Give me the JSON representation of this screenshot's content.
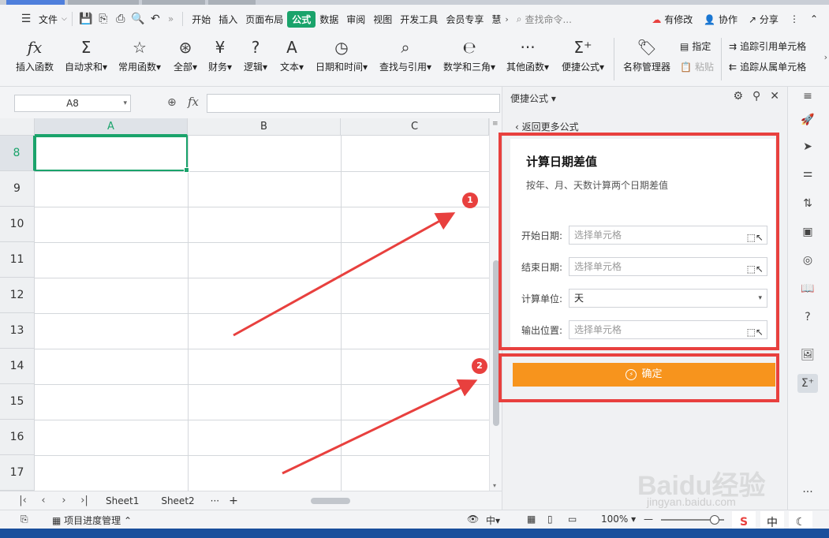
{
  "menubar": {
    "file_label": "文件",
    "tabs": [
      "开始",
      "插入",
      "页面布局",
      "公式",
      "数据",
      "审阅",
      "视图",
      "开发工具",
      "会员专享",
      "慧"
    ],
    "active_tab": "公式",
    "more": "»",
    "search_placeholder": "查找命令...",
    "modified": "有修改",
    "collab": "协作",
    "share": "分享"
  },
  "ribbon": {
    "buttons": [
      "插入函数",
      "自动求和",
      "常用函数",
      "全部",
      "财务",
      "逻辑",
      "文本",
      "日期和时间",
      "查找与引用",
      "数学和三角",
      "其他函数",
      "便捷公式",
      "名称管理器"
    ],
    "assign": "指定",
    "paste": "粘贴",
    "trace_precedents": "追踪引用单元格",
    "trace_dependents": "追踪从属单元格"
  },
  "formula_bar": {
    "name_box": "A8",
    "fx": "fx",
    "value": ""
  },
  "grid": {
    "columns": [
      "A",
      "B",
      "C"
    ],
    "rows": [
      "8",
      "9",
      "10",
      "11",
      "12",
      "13",
      "14",
      "15",
      "16",
      "17"
    ],
    "selected_col": "A",
    "selected_row": "8"
  },
  "sheets": {
    "tabs": [
      "Sheet1",
      "Sheet2"
    ],
    "more": "···",
    "add": "+"
  },
  "panel": {
    "title": "便捷公式",
    "back": "返回更多公式",
    "card_title": "计算日期差值",
    "card_desc": "按年、月、天数计算两个日期差值",
    "fields": [
      {
        "label": "开始日期:",
        "placeholder": "选择单元格"
      },
      {
        "label": "结束日期:",
        "placeholder": "选择单元格"
      },
      {
        "label": "计算单位:",
        "value": "天"
      },
      {
        "label": "输出位置:",
        "placeholder": "选择单元格"
      }
    ],
    "confirm": "确定"
  },
  "annotations": {
    "marker1": "1",
    "marker2": "2"
  },
  "status": {
    "project": "项目进度管理",
    "zoom": "100%",
    "ime": "中"
  },
  "watermark": {
    "logo": "Baidu经验",
    "url": "jingyan.baidu.com"
  },
  "colors": {
    "accent_green": "#1aa36b",
    "confirm_orange": "#f7941d",
    "annotation_red": "#e8403e"
  }
}
